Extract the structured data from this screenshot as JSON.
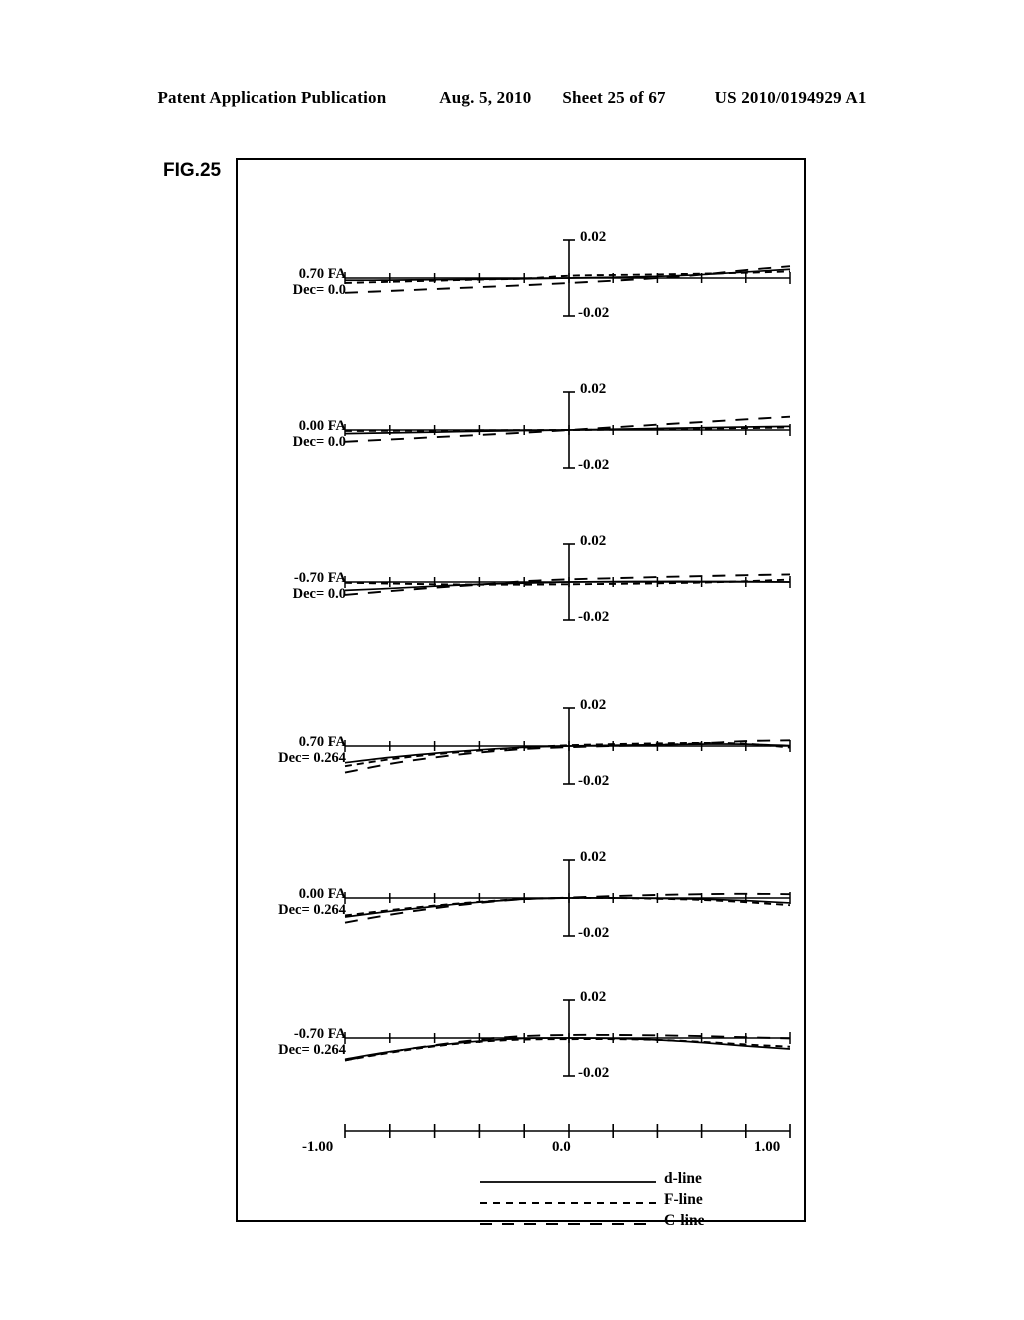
{
  "header": {
    "publication": "Patent Application Publication",
    "date": "Aug. 5, 2010",
    "sheet": "Sheet 25 of 67",
    "docnum": "US 2010/0194929 A1"
  },
  "figure": {
    "label": "FIG.25"
  },
  "chart_data": {
    "type": "line",
    "title": "FIG.25",
    "xlabel": "",
    "ylabel": "",
    "xlim": [
      -1.0,
      1.0
    ],
    "ylim": [
      -0.02,
      0.02
    ],
    "x_tick_labels": [
      "-1.00",
      "0.0",
      "1.00"
    ],
    "x_tick_values": [
      -1.0,
      0.0,
      1.0
    ],
    "x_minor_ticks": 10,
    "y_tick_labels": [
      "0.02",
      "-0.02"
    ],
    "y_tick_values": [
      0.02,
      -0.02
    ],
    "grid": false,
    "legend_position": "bottom-center",
    "legend": [
      {
        "name": "d-line",
        "style": "solid"
      },
      {
        "name": "F-line",
        "style": "dashed-short"
      },
      {
        "name": "C-line",
        "style": "dashed-long"
      }
    ],
    "subplots": [
      {
        "caption_line1": "0.70 FA",
        "caption_line2": "Dec= 0.0",
        "x": [
          -1.0,
          -0.8,
          -0.6,
          -0.4,
          -0.2,
          0.0,
          0.2,
          0.4,
          0.6,
          0.8,
          1.0
        ],
        "series": [
          {
            "name": "d-line",
            "style": "solid",
            "values": [
              -0.0012,
              -0.0011,
              -0.0009,
              -0.0007,
              -0.0004,
              0.0,
              0.0004,
              0.0009,
              0.0018,
              0.0032,
              0.0046
            ]
          },
          {
            "name": "F-line",
            "style": "dashed-short",
            "values": [
              -0.0026,
              -0.002,
              -0.0014,
              -0.0008,
              -0.0003,
              0.0012,
              0.0016,
              0.0019,
              0.0023,
              0.0028,
              0.0035
            ]
          },
          {
            "name": "C-line",
            "style": "dashed-long",
            "values": [
              -0.0078,
              -0.0068,
              -0.0058,
              -0.0048,
              -0.0038,
              -0.0026,
              -0.0014,
              0.0,
              0.0018,
              0.0042,
              0.0062
            ]
          }
        ]
      },
      {
        "caption_line1": "0.00 FA",
        "caption_line2": "Dec= 0.0",
        "x": [
          -1.0,
          -0.8,
          -0.6,
          -0.4,
          -0.2,
          0.0,
          0.2,
          0.4,
          0.6,
          0.8,
          1.0
        ],
        "series": [
          {
            "name": "d-line",
            "style": "solid",
            "values": [
              -0.0019,
              -0.0015,
              -0.0011,
              -0.0007,
              -0.0003,
              0.0,
              0.0004,
              0.0008,
              0.0012,
              0.0016,
              0.0019
            ]
          },
          {
            "name": "F-line",
            "style": "dashed-short",
            "values": [
              -0.0005,
              -0.0004,
              -0.0003,
              -0.0002,
              -0.0001,
              0.0,
              0.0002,
              0.0004,
              0.0007,
              0.001,
              0.0013
            ]
          },
          {
            "name": "C-line",
            "style": "dashed-long",
            "values": [
              -0.0062,
              -0.005,
              -0.0038,
              -0.0026,
              -0.0014,
              0.0,
              0.0014,
              0.0028,
              0.0042,
              0.0056,
              0.007
            ]
          }
        ]
      },
      {
        "caption_line1": "-0.70 FA",
        "caption_line2": "Dec= 0.0",
        "x": [
          -1.0,
          -0.8,
          -0.6,
          -0.4,
          -0.2,
          0.0,
          0.2,
          0.4,
          0.6,
          0.8,
          1.0
        ],
        "series": [
          {
            "name": "d-line",
            "style": "solid",
            "values": [
              -0.0044,
              -0.0034,
              -0.0022,
              -0.0012,
              -0.0006,
              0.0,
              0.0002,
              0.0003,
              0.0003,
              0.0002,
              0.0
            ]
          },
          {
            "name": "F-line",
            "style": "dashed-short",
            "values": [
              -0.0004,
              -0.0008,
              -0.0012,
              -0.0014,
              -0.0014,
              -0.0012,
              -0.001,
              -0.0007,
              -0.0003,
              0.0004,
              0.0013
            ]
          },
          {
            "name": "C-line",
            "style": "dashed-long",
            "values": [
              -0.0068,
              -0.0048,
              -0.003,
              -0.0014,
              0.0004,
              0.0014,
              0.002,
              0.0026,
              0.0031,
              0.0036,
              0.004
            ]
          }
        ]
      },
      {
        "caption_line1": "0.70 FA",
        "caption_line2": "Dec= 0.264",
        "x": [
          -1.0,
          -0.8,
          -0.6,
          -0.4,
          -0.2,
          0.0,
          0.2,
          0.4,
          0.6,
          0.8,
          1.0
        ],
        "series": [
          {
            "name": "d-line",
            "style": "solid",
            "values": [
              -0.0088,
              -0.006,
              -0.0038,
              -0.002,
              -0.0007,
              0.0,
              0.0004,
              0.0007,
              0.001,
              0.001,
              0.0002
            ]
          },
          {
            "name": "F-line",
            "style": "dashed-short",
            "values": [
              -0.0106,
              -0.007,
              -0.0044,
              -0.0024,
              -0.0008,
              0.0004,
              0.001,
              0.0014,
              0.0016,
              0.0012,
              -0.0008
            ]
          },
          {
            "name": "C-line",
            "style": "dashed-long",
            "values": [
              -0.014,
              -0.0094,
              -0.006,
              -0.0034,
              -0.0016,
              -0.0006,
              0.0,
              0.0006,
              0.0014,
              0.0026,
              0.003
            ]
          }
        ]
      },
      {
        "caption_line1": "0.00 FA",
        "caption_line2": "Dec= 0.264",
        "x": [
          -1.0,
          -0.8,
          -0.6,
          -0.4,
          -0.2,
          0.0,
          0.2,
          0.4,
          0.6,
          0.8,
          1.0
        ],
        "series": [
          {
            "name": "d-line",
            "style": "solid",
            "values": [
              -0.01,
              -0.007,
              -0.0044,
              -0.0022,
              -0.0006,
              0.0,
              0.0,
              -0.0002,
              -0.0006,
              -0.0014,
              -0.0026
            ]
          },
          {
            "name": "F-line",
            "style": "dashed-short",
            "values": [
              -0.0092,
              -0.0064,
              -0.004,
              -0.002,
              -0.0005,
              0.0,
              0.0,
              -0.0004,
              -0.001,
              -0.0022,
              -0.0038
            ]
          },
          {
            "name": "C-line",
            "style": "dashed-long",
            "values": [
              -0.013,
              -0.0088,
              -0.0054,
              -0.0026,
              -0.0006,
              0.0002,
              0.001,
              0.0016,
              0.002,
              0.0022,
              0.002
            ]
          }
        ]
      },
      {
        "caption_line1": "-0.70 FA",
        "caption_line2": "Dec= 0.264",
        "x": [
          -1.0,
          -0.8,
          -0.6,
          -0.4,
          -0.2,
          0.0,
          0.2,
          0.4,
          0.6,
          0.8,
          1.0
        ],
        "series": [
          {
            "name": "d-line",
            "style": "solid",
            "values": [
              -0.0112,
              -0.0072,
              -0.004,
              -0.0016,
              -0.0002,
              0.0,
              -0.0002,
              -0.001,
              -0.0024,
              -0.0042,
              -0.0058
            ]
          },
          {
            "name": "F-line",
            "style": "dashed-short",
            "values": [
              -0.0118,
              -0.0078,
              -0.0044,
              -0.002,
              -0.0008,
              -0.0006,
              -0.0006,
              -0.001,
              -0.002,
              -0.0034,
              -0.0046
            ]
          },
          {
            "name": "C-line",
            "style": "dashed-long",
            "values": [
              -0.0118,
              -0.0074,
              -0.0038,
              -0.0008,
              0.001,
              0.0016,
              0.0016,
              0.0014,
              0.001,
              0.0004,
              -0.0002
            ]
          }
        ]
      }
    ]
  }
}
